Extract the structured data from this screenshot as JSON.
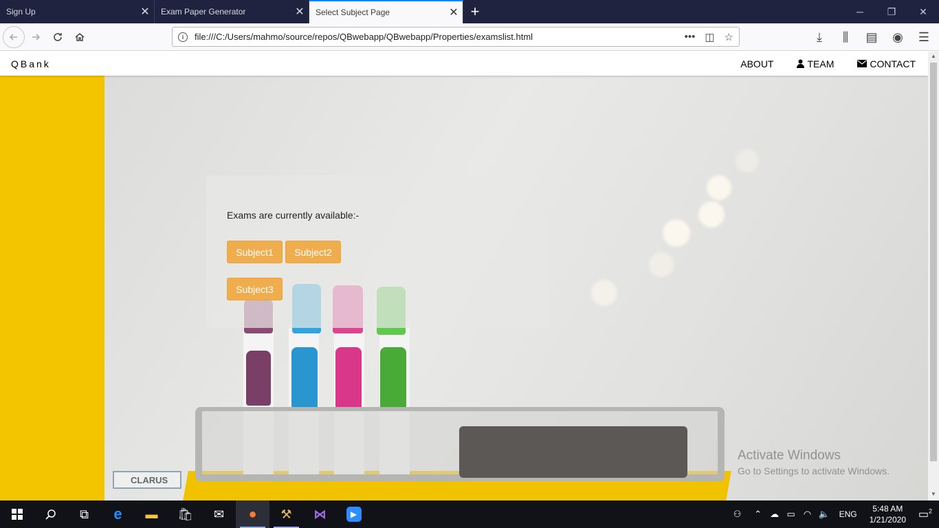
{
  "browser": {
    "tabs": [
      {
        "title": "Sign Up",
        "active": false
      },
      {
        "title": "Exam Paper Generator",
        "active": false
      },
      {
        "title": "Select Subject Page",
        "active": true
      }
    ],
    "url": "file:///C:/Users/mahmo/source/repos/QBwebapp/QBwebapp/Properties/examslist.html"
  },
  "site": {
    "brand": "QBank",
    "nav": {
      "about": "ABOUT",
      "team": "TEAM",
      "contact": "CONTACT"
    },
    "panel": {
      "text": "Exams are currently available:-",
      "subjects": [
        "Subject1",
        "Subject2",
        "Subject3"
      ]
    },
    "tray_logo": "CLARUS"
  },
  "watermark": {
    "line1": "Activate Windows",
    "line2": "Go to Settings to activate Windows."
  },
  "taskbar": {
    "lang": "ENG",
    "time": "5:48 AM",
    "date": "1/21/2020",
    "notifications": "2"
  },
  "colors": {
    "accent_button": "#f0ad4e",
    "tab_accent": "#0a84ff",
    "yellow_wall": "#f2c500"
  }
}
